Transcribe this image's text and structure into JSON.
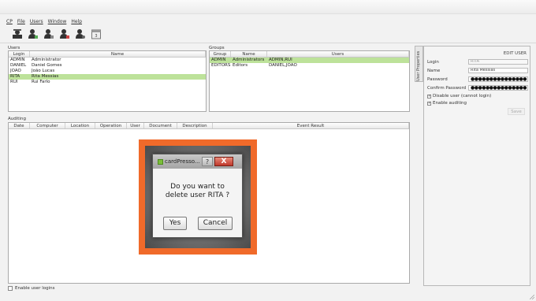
{
  "menu": [
    "CP",
    "File",
    "Users",
    "Window",
    "Help"
  ],
  "toolbar": {
    "icons": [
      "users-group-icon",
      "add-user-icon",
      "edit-user-icon",
      "delete-user-icon",
      "user-settings-icon",
      "calendar-icon"
    ]
  },
  "users": {
    "title": "Users",
    "columns": [
      "Login",
      "Name"
    ],
    "rows": [
      {
        "login": "ADMIN",
        "name": "Administrator"
      },
      {
        "login": "DANIEL",
        "name": "Daniel Gomes"
      },
      {
        "login": "JOÃO",
        "name": "João Lucas"
      },
      {
        "login": "RITA",
        "name": "Rita Messias"
      },
      {
        "login": "RUI",
        "name": "Rui Farlo"
      }
    ],
    "selected_index": 3
  },
  "groups": {
    "title": "Groups",
    "columns": [
      "Group",
      "Name",
      "Users"
    ],
    "rows": [
      {
        "group": "ADMIN",
        "name": "Administrators",
        "users": "ADMIN,RUI"
      },
      {
        "group": "EDITORS",
        "name": "Editors",
        "users": "DANIEL,JOÃO"
      }
    ],
    "selected_index": 0
  },
  "auditing": {
    "title": "Auditing",
    "columns": [
      "Date",
      "Computer",
      "Location",
      "Operation",
      "User",
      "Document",
      "Description",
      "Event Result"
    ]
  },
  "user_properties": {
    "tab_label": "User Properties",
    "title": "EDIT USER",
    "login_label": "Login",
    "login_value": "RITA",
    "name_label": "Name",
    "name_value": "Rita Messias",
    "password_label": "Password",
    "password_value": "●●●●●●●●●●●●●●●",
    "confirm_label": "Confirm Password",
    "confirm_value": "●●●●●●●●●●●●●●●",
    "disable_label": "Disable user (cannot login)",
    "disable_checked": true,
    "auditing_label": "Enable auditing",
    "auditing_checked": true,
    "save_label": "Save"
  },
  "enable_logins_label": "Enable user logins",
  "dialog": {
    "title": "cardPresso...",
    "help": "?",
    "close": "X",
    "message_line1": "Do you want to",
    "message_line2": "delete user RITA ?",
    "yes_label": "Yes",
    "cancel_label": "Cancel"
  },
  "colors": {
    "selection": "#bde29a",
    "highlight": "#f06a2a"
  }
}
